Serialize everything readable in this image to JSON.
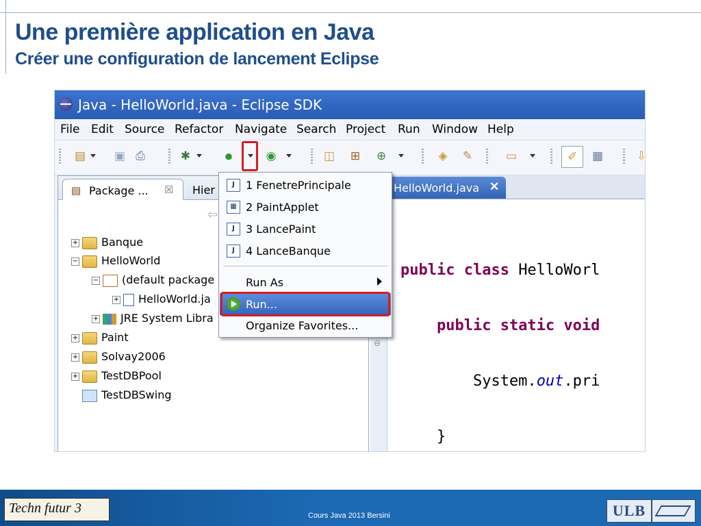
{
  "slide": {
    "title": "Une première application en Java",
    "subtitle": "Créer une configuration de lancement Eclipse"
  },
  "window": {
    "title": "Java - HelloWorld.java - Eclipse SDK"
  },
  "menu": [
    "File",
    "Edit",
    "Source",
    "Refactor",
    "Navigate",
    "Search",
    "Project",
    "Run",
    "Window",
    "Help"
  ],
  "package_explorer": {
    "tab_label": "Package ...",
    "tab_close": "☒",
    "hierarchy_tab": "Hier",
    "tree": [
      {
        "label": "Banque",
        "toggle": "+"
      },
      {
        "label": "HelloWorld",
        "toggle": "−"
      },
      {
        "label": "(default package",
        "toggle": "−"
      },
      {
        "label": "HelloWorld.ja",
        "toggle": "+"
      },
      {
        "label": "JRE System Libra",
        "toggle": "+"
      },
      {
        "label": "Paint",
        "toggle": "+"
      },
      {
        "label": "Solvay2006",
        "toggle": "+"
      },
      {
        "label": "TestDBPool",
        "toggle": "+"
      },
      {
        "label": "TestDBSwing",
        "toggle": ""
      }
    ]
  },
  "editor": {
    "tab_label": "HelloWorld.java",
    "tab_close": "✕",
    "code": {
      "l1_kw": "public class ",
      "l1_rest": "HelloWorl",
      "l2_kw": "    public static void",
      "l3_a": "        System.",
      "l3_it": "out",
      "l3_b": ".pri",
      "l4": "    }",
      "l5": "}"
    }
  },
  "dropdown": {
    "items": [
      "1 FenetrePrincipale",
      "2 PaintApplet",
      "3 LancePaint",
      "4 LanceBanque"
    ],
    "run_as": "Run As",
    "run": "Run...",
    "organize": "Organize Favorites..."
  },
  "footer": {
    "logo_left": "Techn futur 3",
    "course": "Cours Java 2013 Bersini",
    "logo_right": "ULB"
  },
  "colors": {
    "title": "#1f4e8c",
    "highlight": "#d21d24",
    "selection": "#3264bc"
  }
}
